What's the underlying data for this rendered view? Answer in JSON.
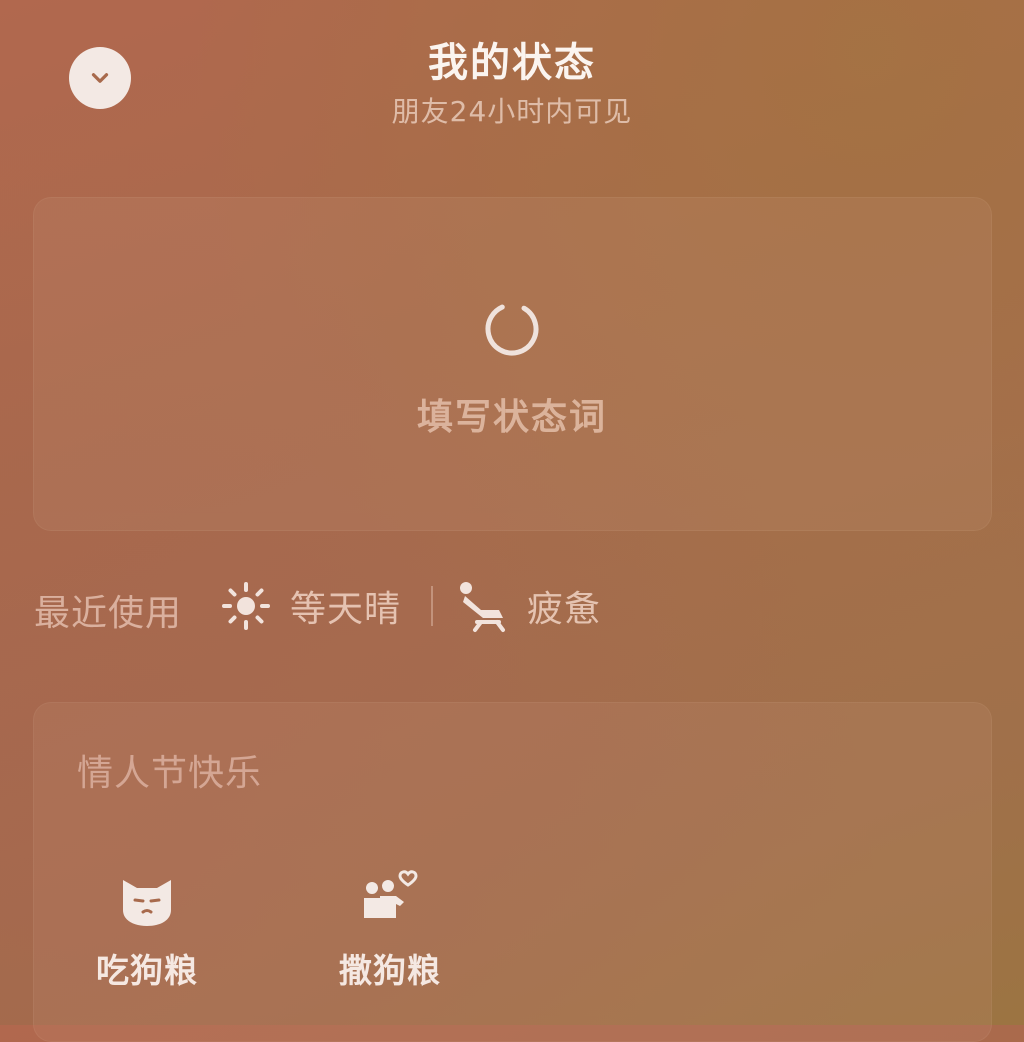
{
  "header": {
    "title": "我的状态",
    "subtitle": "朋友24小时内可见"
  },
  "status_input": {
    "placeholder": "填写状态词"
  },
  "recent": {
    "label": "最近使用",
    "items": [
      {
        "icon": "sun-icon",
        "label": "等天晴"
      },
      {
        "icon": "reclining-person-icon",
        "label": "疲惫"
      }
    ]
  },
  "theme_section": {
    "title": "情人节快乐",
    "items": [
      {
        "icon": "cat-face-icon",
        "label": "吃狗粮"
      },
      {
        "icon": "couple-heart-icon",
        "label": "撒狗粮"
      }
    ]
  },
  "colors": {
    "background": "#a86a4c",
    "icon_fill": "#f3e9e4"
  }
}
